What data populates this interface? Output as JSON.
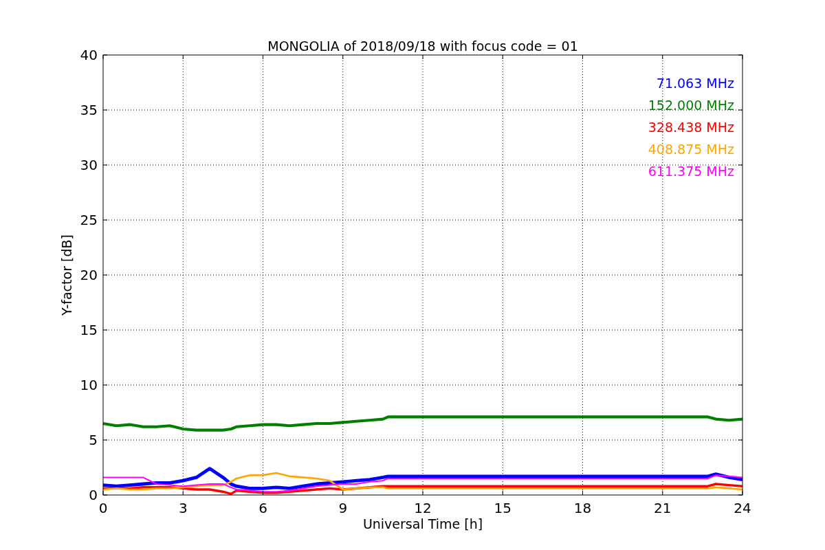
{
  "chart_data": {
    "type": "line",
    "title": "MONGOLIA of 2018/09/18 with focus code = 01",
    "xlabel": "Universal Time [h]",
    "ylabel": "Y-factor [dB]",
    "x": [
      0,
      0.5,
      1,
      1.5,
      2,
      2.5,
      3,
      3.5,
      4,
      4.5,
      4.8,
      5,
      5.5,
      6,
      6.5,
      7,
      7.5,
      8,
      8.5,
      9,
      9.5,
      10,
      10.5,
      10.7,
      22.7,
      23,
      23.5,
      24
    ],
    "series": [
      {
        "name": "71.063 MHz",
        "color": "#0000ff",
        "values": [
          0.9,
          0.8,
          0.9,
          1.0,
          1.1,
          1.1,
          1.3,
          1.6,
          2.4,
          1.6,
          1.0,
          0.8,
          0.6,
          0.6,
          0.7,
          0.6,
          0.8,
          1.0,
          1.1,
          1.2,
          1.3,
          1.4,
          1.6,
          1.7,
          1.7,
          1.9,
          1.6,
          1.4
        ]
      },
      {
        "name": "152.000 MHz",
        "color": "#008000",
        "values": [
          6.5,
          6.3,
          6.4,
          6.2,
          6.2,
          6.3,
          6.0,
          5.9,
          5.9,
          5.9,
          6.0,
          6.2,
          6.3,
          6.4,
          6.4,
          6.3,
          6.4,
          6.5,
          6.5,
          6.6,
          6.7,
          6.8,
          6.9,
          7.1,
          7.1,
          6.9,
          6.8,
          6.9
        ]
      },
      {
        "name": "328.438 MHz",
        "color": "#ff0000",
        "values": [
          0.6,
          0.6,
          0.6,
          0.7,
          0.7,
          0.7,
          0.6,
          0.5,
          0.5,
          0.3,
          0.1,
          0.4,
          0.3,
          0.2,
          0.2,
          0.3,
          0.4,
          0.5,
          0.6,
          0.5,
          0.6,
          0.7,
          0.8,
          0.8,
          0.8,
          1.0,
          0.9,
          0.8
        ]
      },
      {
        "name": "408.875 MHz",
        "color": "#ffa500",
        "values": [
          0.5,
          0.6,
          0.5,
          0.5,
          0.6,
          0.6,
          0.7,
          0.8,
          0.9,
          0.9,
          1.2,
          1.5,
          1.8,
          1.8,
          2.0,
          1.7,
          1.6,
          1.5,
          1.3,
          0.5,
          0.6,
          0.7,
          0.7,
          0.6,
          0.6,
          0.7,
          0.6,
          0.5
        ]
      },
      {
        "name": "611.375 MHz",
        "color": "#ff00ff",
        "values": [
          1.6,
          1.6,
          1.6,
          1.6,
          1.0,
          0.9,
          0.8,
          0.9,
          1.0,
          1.0,
          0.7,
          0.5,
          0.4,
          0.3,
          0.3,
          0.4,
          0.6,
          0.8,
          0.9,
          1.0,
          1.0,
          1.2,
          1.3,
          1.5,
          1.5,
          1.8,
          1.7,
          1.6
        ]
      }
    ],
    "xlim": [
      0,
      24
    ],
    "ylim": [
      0,
      40
    ],
    "xticks": [
      0,
      3,
      6,
      9,
      12,
      15,
      18,
      21,
      24
    ],
    "yticks": [
      0,
      5,
      10,
      15,
      20,
      25,
      30,
      35,
      40
    ],
    "grid": true
  }
}
